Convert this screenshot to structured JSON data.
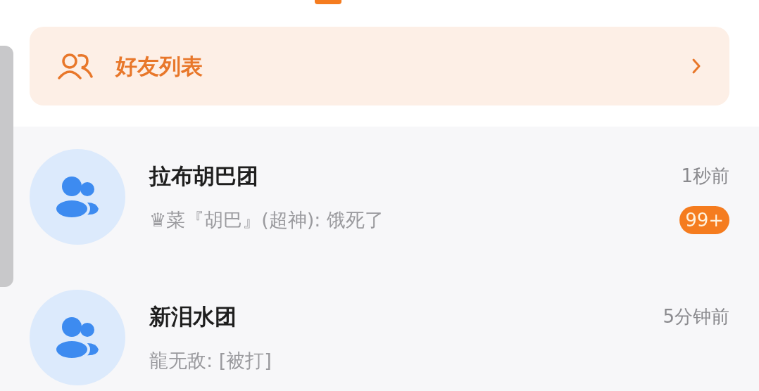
{
  "friend_list_entry": {
    "label": "好友列表"
  },
  "chats": [
    {
      "name": "拉布胡巴团",
      "preview": "♛菜『胡巴』(超神): 饿死了",
      "time": "1秒前",
      "unread": "99+"
    },
    {
      "name": "新泪水团",
      "preview": "龍无敌: [被打]",
      "time": "5分钟前"
    }
  ]
}
